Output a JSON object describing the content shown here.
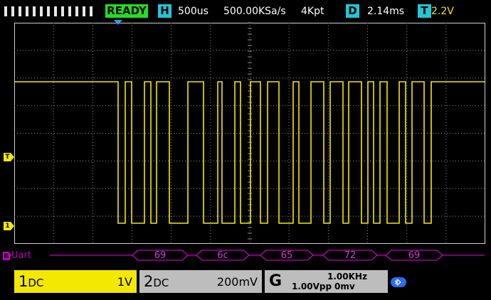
{
  "status_bar": {
    "run_state": "READY",
    "timebase_badge": "H",
    "timebase": "500us",
    "sample_rate": "500.00KSa/s",
    "memory_depth": "4Kpt",
    "delay_badge": "D",
    "delay": "2.14ms",
    "trigger_badge": "T",
    "trigger_level": "2.2V"
  },
  "markers": {
    "trigger_marker": "T",
    "channel1_marker": "1"
  },
  "decode": {
    "label": "Uart",
    "bus_badge": "B",
    "packets": [
      "69",
      "6c",
      "65",
      "72",
      "69"
    ]
  },
  "channel1": {
    "name": "1",
    "coupling": "DC",
    "scale": "1V"
  },
  "channel2": {
    "name": "2",
    "coupling": "DC",
    "scale": "200mV"
  },
  "generator": {
    "label": "G",
    "waveform": "sine",
    "frequency": "1.00KHz",
    "amplitude": "1.00Vpp",
    "offset": "0mv"
  },
  "colors": {
    "channel1": "#f3e800",
    "decode": "#c400c4",
    "ready": "#21e021",
    "badge": "#22c6d6",
    "bluetooth": "#2a6cf0"
  }
}
